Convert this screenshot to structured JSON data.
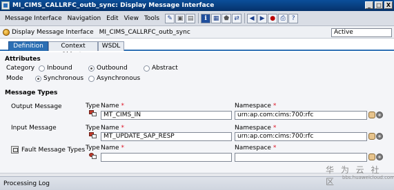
{
  "window": {
    "title": "MI_CIMS_CALLRFC_outb_sync: Display Message Interface",
    "buttons": [
      "_",
      "□",
      "X"
    ]
  },
  "menubar": {
    "items": [
      "Message Interface",
      "Navigation",
      "Edit",
      "View",
      "Tools"
    ]
  },
  "header": {
    "label": "Display Message Interface",
    "name": "MI_CIMS_CALLRFC_outb_sync",
    "status": "Active"
  },
  "tabs": [
    {
      "label": "Definition",
      "active": true
    },
    {
      "label": "Context Objects",
      "active": false
    },
    {
      "label": "WSDL",
      "active": false
    }
  ],
  "attributes": {
    "title": "Attributes",
    "category_label": "Category",
    "category_options": [
      "Inbound",
      "Outbound",
      "Abstract"
    ],
    "category_selected": "Outbound",
    "mode_label": "Mode",
    "mode_options": [
      "Synchronous",
      "Asynchronous"
    ],
    "mode_selected": "Synchronous"
  },
  "message_types": {
    "title": "Message Types",
    "type_label": "Type",
    "name_label": "Name",
    "namespace_label": "Namespace",
    "required_marker": "*",
    "rows": [
      {
        "label": "Output Message",
        "name": "MT_CIMS_IN",
        "namespace": "urn:ap.com:cims:700:rfc"
      },
      {
        "label": "Input Message",
        "name": "MT_UPDATE_SAP_RESP",
        "namespace": "urn:ap.com:cims:700:rfc"
      },
      {
        "label": "Fault Message Types",
        "name": "",
        "namespace": ""
      }
    ]
  },
  "footer": {
    "processing_log": "Processing Log",
    "watermark": "华 为 云 社 区",
    "watermark_url": "bbs.huaweicloud.com"
  },
  "colors": {
    "title_bar": "#0b4f9a",
    "active_tab": "#2c6fb4",
    "required": "#d12222"
  }
}
